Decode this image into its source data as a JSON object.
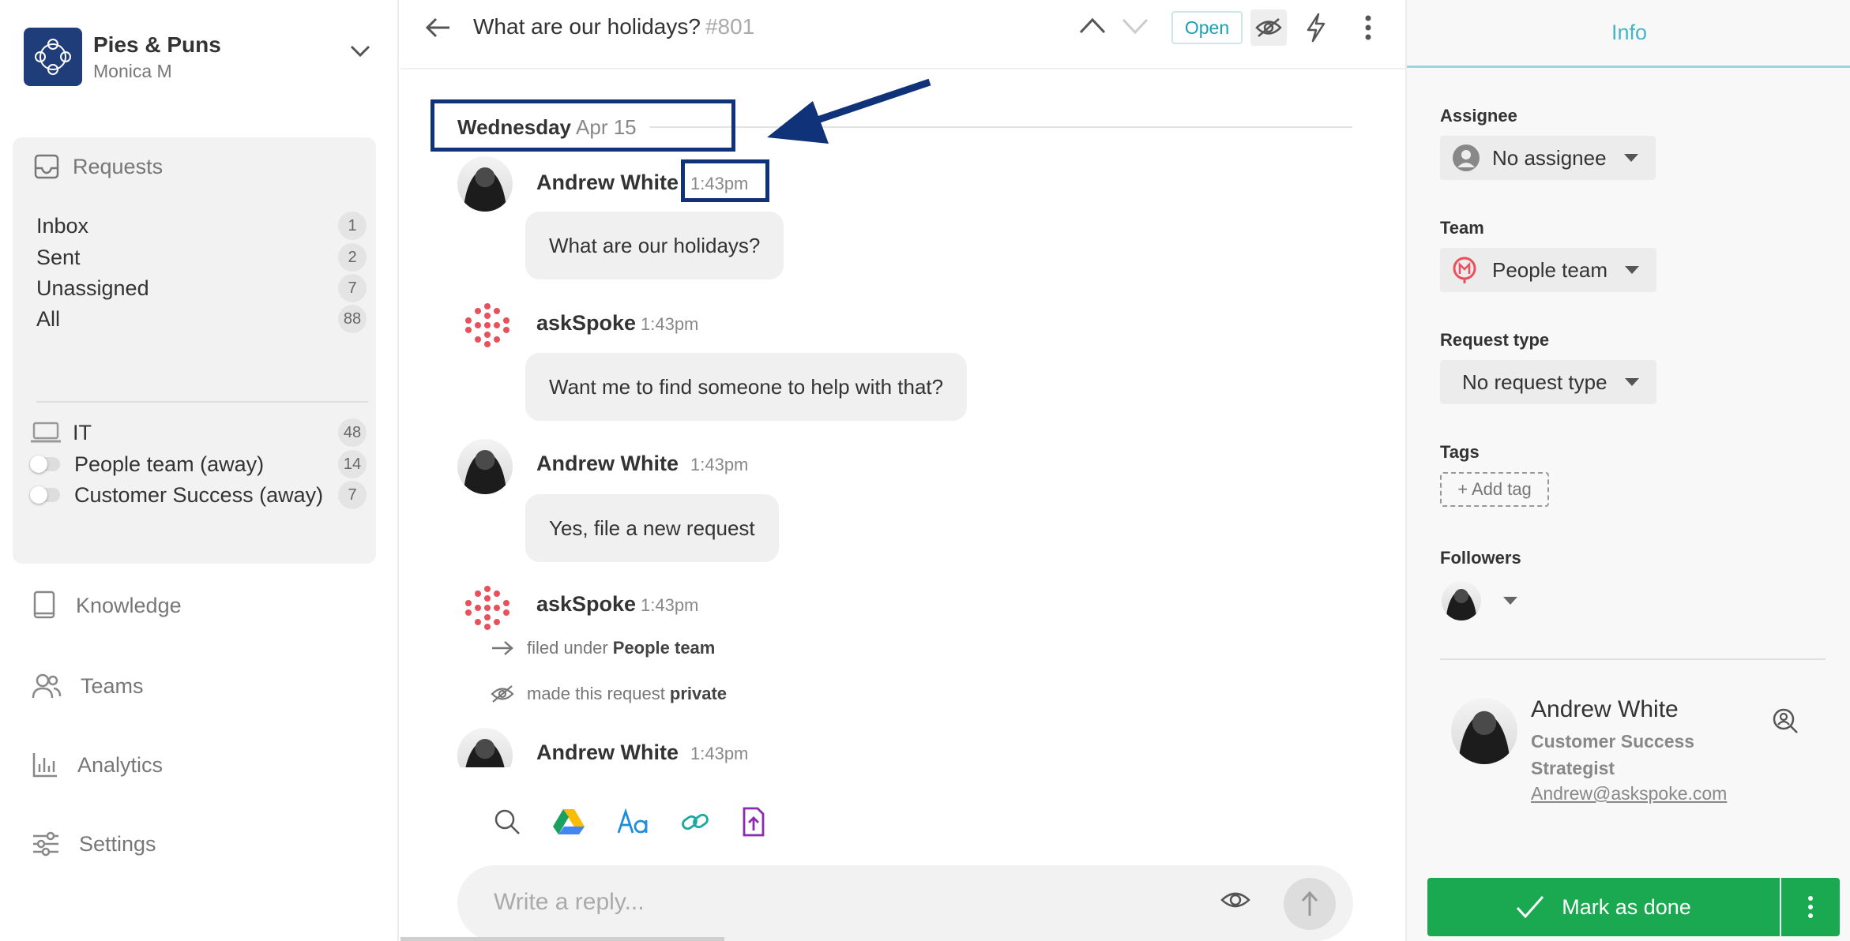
{
  "workspace": {
    "name": "Pies & Puns",
    "user": "Monica M"
  },
  "requests": {
    "heading": "Requests",
    "items": [
      {
        "label": "Inbox",
        "count": "1"
      },
      {
        "label": "Sent",
        "count": "2"
      },
      {
        "label": "Unassigned",
        "count": "7"
      },
      {
        "label": "All",
        "count": "88"
      }
    ],
    "teams": [
      {
        "label": "IT",
        "count": "48"
      },
      {
        "label": "People team (away)",
        "count": "14"
      },
      {
        "label": "Customer Success (away)",
        "count": "7"
      }
    ]
  },
  "nav": {
    "knowledge": "Knowledge",
    "teams": "Teams",
    "analytics": "Analytics",
    "settings": "Settings"
  },
  "thread": {
    "title": "What are our holidays?",
    "number": "#801",
    "status": "Open"
  },
  "day": {
    "weekday": "Wednesday",
    "date": "Apr 15"
  },
  "messages": [
    {
      "author": "Andrew White",
      "time": "1:43pm",
      "text": "What are our holidays?"
    },
    {
      "author": "askSpoke",
      "time": "1:43pm",
      "text": "Want me to find someone to help with that?"
    },
    {
      "author": "Andrew White",
      "time": "1:43pm",
      "text": "Yes, file a new request"
    },
    {
      "author": "askSpoke",
      "time": "1:43pm"
    },
    {
      "author": "Andrew White",
      "time": "1:43pm"
    }
  ],
  "events": [
    {
      "prefix": "filed under",
      "value": "People team"
    },
    {
      "prefix": "made this request",
      "value": "private"
    }
  ],
  "composer": {
    "placeholder": "Write a reply..."
  },
  "info": {
    "tab": "Info",
    "assignee_label": "Assignee",
    "assignee_value": "No assignee",
    "team_label": "Team",
    "team_value": "People team",
    "request_type_label": "Request type",
    "request_type_value": "No request type",
    "tags_label": "Tags",
    "add_tag": "+ Add tag",
    "followers_label": "Followers"
  },
  "profile": {
    "name": "Andrew White",
    "title": "Customer Success Strategist",
    "email": "Andrew@askspoke.com"
  },
  "actions": {
    "done": "Mark as done"
  },
  "colors": {
    "accent": "#1ba1b4",
    "highlight": "#0f3278",
    "done": "#1aa950",
    "spoke": "#e8505b"
  }
}
